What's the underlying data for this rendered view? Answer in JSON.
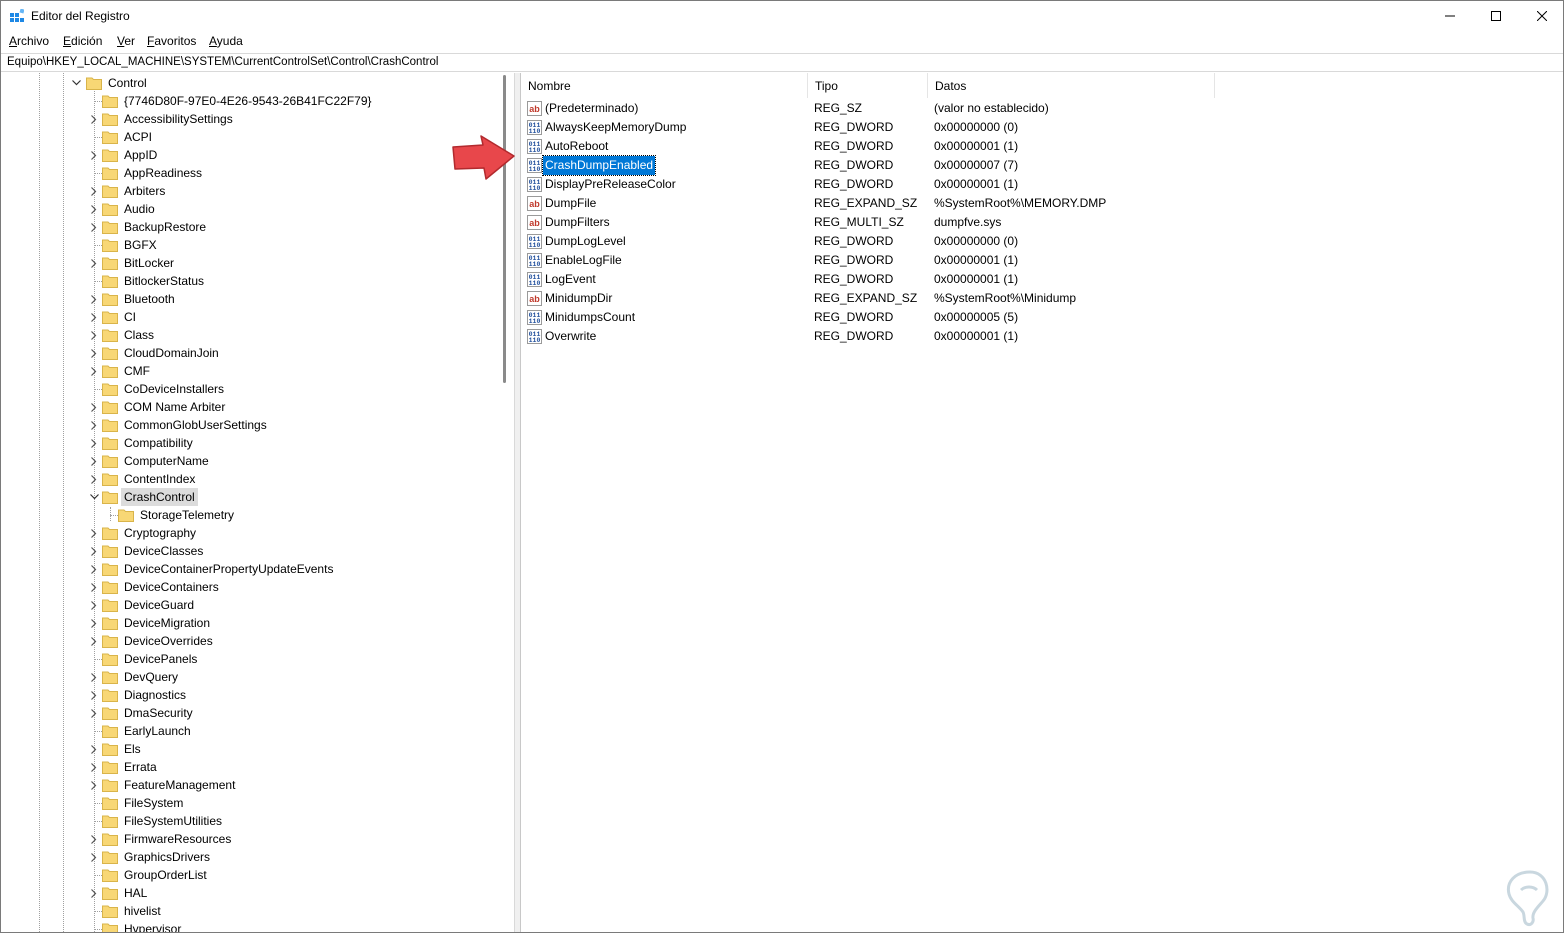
{
  "window": {
    "title": "Editor del Registro"
  },
  "menu": {
    "items": [
      {
        "u": "A",
        "rest": "rchivo"
      },
      {
        "u": "E",
        "rest": "dición"
      },
      {
        "u": "V",
        "rest": "er"
      },
      {
        "u": "F",
        "rest": "avoritos"
      },
      {
        "u": "A",
        "rest": "yuda"
      }
    ]
  },
  "address": "Equipo\\HKEY_LOCAL_MACHINE\\SYSTEM\\CurrentControlSet\\Control\\CrashControl",
  "tree": {
    "parent": "Control",
    "items": [
      {
        "label": "{7746D80F-97E0-4E26-9543-26B41FC22F79}",
        "expandable": false
      },
      {
        "label": "AccessibilitySettings",
        "expandable": true
      },
      {
        "label": "ACPI",
        "expandable": false
      },
      {
        "label": "AppID",
        "expandable": true
      },
      {
        "label": "AppReadiness",
        "expandable": false
      },
      {
        "label": "Arbiters",
        "expandable": true
      },
      {
        "label": "Audio",
        "expandable": true
      },
      {
        "label": "BackupRestore",
        "expandable": true
      },
      {
        "label": "BGFX",
        "expandable": false
      },
      {
        "label": "BitLocker",
        "expandable": true
      },
      {
        "label": "BitlockerStatus",
        "expandable": false
      },
      {
        "label": "Bluetooth",
        "expandable": true
      },
      {
        "label": "CI",
        "expandable": true
      },
      {
        "label": "Class",
        "expandable": true
      },
      {
        "label": "CloudDomainJoin",
        "expandable": true
      },
      {
        "label": "CMF",
        "expandable": true
      },
      {
        "label": "CoDeviceInstallers",
        "expandable": false
      },
      {
        "label": "COM Name Arbiter",
        "expandable": true
      },
      {
        "label": "CommonGlobUserSettings",
        "expandable": true
      },
      {
        "label": "Compatibility",
        "expandable": true
      },
      {
        "label": "ComputerName",
        "expandable": true
      },
      {
        "label": "ContentIndex",
        "expandable": true
      },
      {
        "label": "CrashControl",
        "expandable": true,
        "expanded": true,
        "selected": true
      },
      {
        "label": "StorageTelemetry",
        "expandable": false,
        "child": true
      },
      {
        "label": "Cryptography",
        "expandable": true
      },
      {
        "label": "DeviceClasses",
        "expandable": true
      },
      {
        "label": "DeviceContainerPropertyUpdateEvents",
        "expandable": true
      },
      {
        "label": "DeviceContainers",
        "expandable": true
      },
      {
        "label": "DeviceGuard",
        "expandable": true
      },
      {
        "label": "DeviceMigration",
        "expandable": true
      },
      {
        "label": "DeviceOverrides",
        "expandable": true
      },
      {
        "label": "DevicePanels",
        "expandable": false
      },
      {
        "label": "DevQuery",
        "expandable": true
      },
      {
        "label": "Diagnostics",
        "expandable": true
      },
      {
        "label": "DmaSecurity",
        "expandable": true
      },
      {
        "label": "EarlyLaunch",
        "expandable": false
      },
      {
        "label": "Els",
        "expandable": true
      },
      {
        "label": "Errata",
        "expandable": true
      },
      {
        "label": "FeatureManagement",
        "expandable": true
      },
      {
        "label": "FileSystem",
        "expandable": false
      },
      {
        "label": "FileSystemUtilities",
        "expandable": false
      },
      {
        "label": "FirmwareResources",
        "expandable": true
      },
      {
        "label": "GraphicsDrivers",
        "expandable": true
      },
      {
        "label": "GroupOrderList",
        "expandable": false
      },
      {
        "label": "HAL",
        "expandable": true
      },
      {
        "label": "hivelist",
        "expandable": false
      },
      {
        "label": "Hypervisor",
        "expandable": false
      }
    ]
  },
  "list": {
    "columns": [
      "Nombre",
      "Tipo",
      "Datos"
    ],
    "rows": [
      {
        "name": "(Predeterminado)",
        "type": "REG_SZ",
        "data": "(valor no establecido)",
        "icon": "string"
      },
      {
        "name": "AlwaysKeepMemoryDump",
        "type": "REG_DWORD",
        "data": "0x00000000 (0)",
        "icon": "binary"
      },
      {
        "name": "AutoReboot",
        "type": "REG_DWORD",
        "data": "0x00000001 (1)",
        "icon": "binary"
      },
      {
        "name": "CrashDumpEnabled",
        "type": "REG_DWORD",
        "data": "0x00000007 (7)",
        "icon": "binary",
        "selected": true
      },
      {
        "name": "DisplayPreReleaseColor",
        "type": "REG_DWORD",
        "data": "0x00000001 (1)",
        "icon": "binary"
      },
      {
        "name": "DumpFile",
        "type": "REG_EXPAND_SZ",
        "data": "%SystemRoot%\\MEMORY.DMP",
        "icon": "string"
      },
      {
        "name": "DumpFilters",
        "type": "REG_MULTI_SZ",
        "data": "dumpfve.sys",
        "icon": "string"
      },
      {
        "name": "DumpLogLevel",
        "type": "REG_DWORD",
        "data": "0x00000000 (0)",
        "icon": "binary"
      },
      {
        "name": "EnableLogFile",
        "type": "REG_DWORD",
        "data": "0x00000001 (1)",
        "icon": "binary"
      },
      {
        "name": "LogEvent",
        "type": "REG_DWORD",
        "data": "0x00000001 (1)",
        "icon": "binary"
      },
      {
        "name": "MinidumpDir",
        "type": "REG_EXPAND_SZ",
        "data": "%SystemRoot%\\Minidump",
        "icon": "string"
      },
      {
        "name": "MinidumpsCount",
        "type": "REG_DWORD",
        "data": "0x00000005 (5)",
        "icon": "binary"
      },
      {
        "name": "Overwrite",
        "type": "REG_DWORD",
        "data": "0x00000001 (1)",
        "icon": "binary"
      }
    ]
  },
  "colors": {
    "selection": "#0078d7",
    "folder": "#f8d775",
    "arrow": "#e8474b"
  }
}
